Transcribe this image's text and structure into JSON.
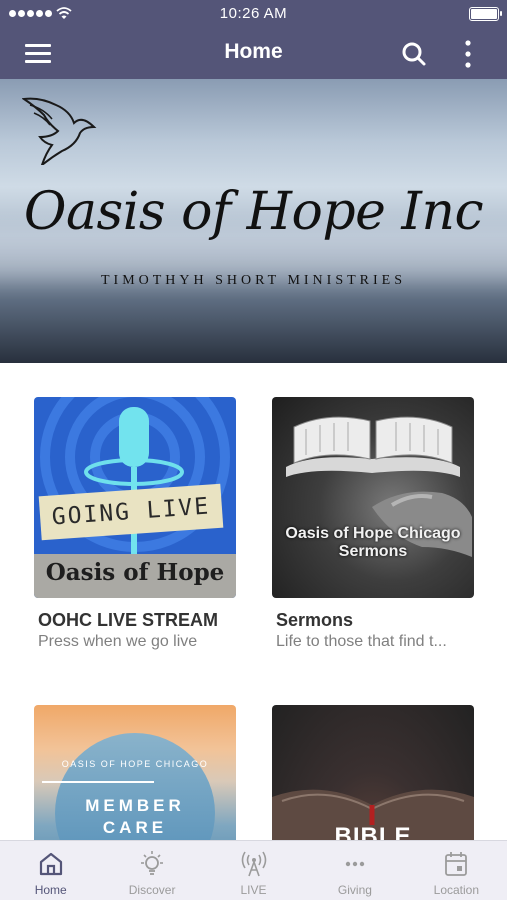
{
  "status_bar": {
    "time": "10:26 AM"
  },
  "nav": {
    "title": "Home"
  },
  "banner": {
    "title": "Oasis of Hope Inc",
    "subtitle": "TIMOTHYH SHORT MINISTRIES"
  },
  "cards": [
    {
      "title": "OOHC LIVE STREAM",
      "subtitle": "Press when we go live",
      "thumb_sign": "GOING LIVE",
      "thumb_footer": "Oasis of Hope"
    },
    {
      "title": "Sermons",
      "subtitle": "Life to those that find t...",
      "thumb_overlay_line1": "Oasis of Hope Chicago",
      "thumb_overlay_line2": "Sermons"
    },
    {
      "thumb_top": "OASIS OF HOPE CHICAGO",
      "thumb_line1": "MEMBER",
      "thumb_line2": "CARE"
    },
    {
      "thumb_text": "BIBLE"
    }
  ],
  "tabs": [
    {
      "label": "Home",
      "icon": "home-icon",
      "active": true
    },
    {
      "label": "Discover",
      "icon": "lightbulb-icon"
    },
    {
      "label": "LIVE",
      "icon": "broadcast-icon"
    },
    {
      "label": "Giving",
      "icon": "more-dots-icon"
    },
    {
      "label": "Location",
      "icon": "calendar-icon"
    }
  ],
  "colors": {
    "nav_bg": "#545578",
    "tab_bg": "#efeef5",
    "active_tab": "#545578",
    "inactive_tab": "#9b9b9b"
  }
}
